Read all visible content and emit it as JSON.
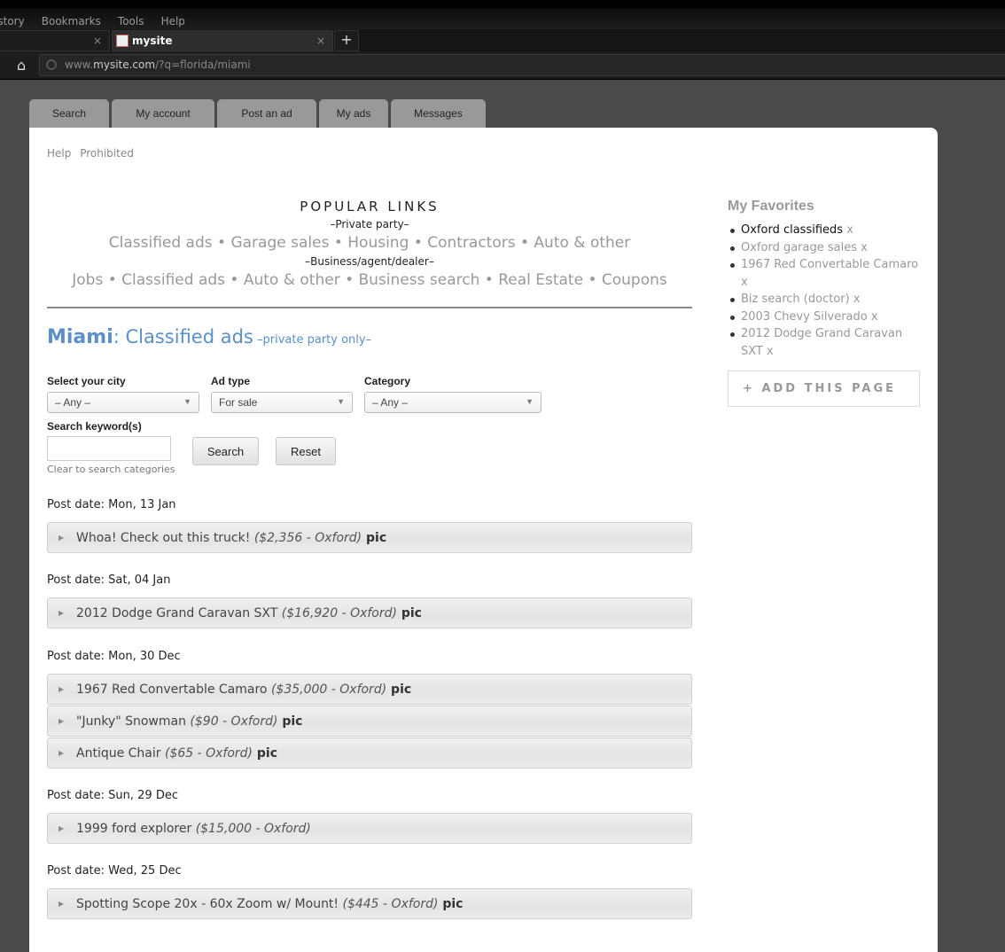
{
  "browser": {
    "menu": [
      "istory",
      "Bookmarks",
      "Tools",
      "Help"
    ],
    "tab_title": "mysite",
    "new_tab": "+",
    "url_prefix": "www.",
    "url_domain": "mysite.com",
    "url_path": "/?q=florida/miami"
  },
  "nav_tabs": [
    "Search",
    "My account",
    "Post an ad",
    "My ads",
    "Messages"
  ],
  "top_links": [
    "Help",
    "Prohibited"
  ],
  "popular": {
    "title": "POPULAR LINKS",
    "private_label": "–Private party–",
    "private_links": "Classified ads • Garage sales • Housing • Contractors • Auto & other",
    "business_label": "–Business/agent/dealer–",
    "business_links": "Jobs • Classified ads • Auto & other • Business search • Real Estate • Coupons"
  },
  "heading": {
    "city": "Miami",
    "title": ": Classified ads",
    "note": " –private party only–"
  },
  "filters": {
    "city_label": "Select your city",
    "city_value": "– Any –",
    "adtype_label": "Ad type",
    "adtype_value": "For sale",
    "category_label": "Category",
    "category_value": "– Any –",
    "keyword_label": "Search keyword(s)",
    "keyword_value": "",
    "hint": "Clear to search categories",
    "search_btn": "Search",
    "reset_btn": "Reset"
  },
  "listings": [
    {
      "date": "Post date: Mon, 13 Jan",
      "ads": [
        {
          "title": "Whoa! Check out this truck! ",
          "meta": "($2,356 - Oxford)",
          "pic": " pic"
        }
      ]
    },
    {
      "date": "Post date: Sat, 04 Jan",
      "ads": [
        {
          "title": "2012 Dodge Grand Caravan SXT ",
          "meta": "($16,920 - Oxford)",
          "pic": " pic"
        }
      ]
    },
    {
      "date": "Post date: Mon, 30 Dec",
      "ads": [
        {
          "title": "1967 Red Convertable Camaro ",
          "meta": "($35,000 - Oxford)",
          "pic": " pic"
        },
        {
          "title": "\"Junky\" Snowman ",
          "meta": "($90 - Oxford)",
          "pic": " pic"
        },
        {
          "title": "Antique Chair ",
          "meta": "($65 - Oxford)",
          "pic": " pic"
        }
      ]
    },
    {
      "date": "Post date: Sun, 29 Dec",
      "ads": [
        {
          "title": "1999 ford explorer ",
          "meta": "($15,000 - Oxford)",
          "pic": ""
        }
      ]
    },
    {
      "date": "Post date: Wed, 25 Dec",
      "ads": [
        {
          "title": "Spotting Scope 20x - 60x Zoom w/ Mount! ",
          "meta": "($445 - Oxford)",
          "pic": " pic"
        }
      ]
    }
  ],
  "favorites": {
    "title": "My Favorites",
    "items": [
      "Oxford classifieds",
      "Oxford garage sales",
      "1967 Red Convertable Camaro",
      "Biz search (doctor)",
      "2003 Chevy Silverado",
      "2012 Dodge Grand Caravan SXT"
    ],
    "remove": "x",
    "add_label": "ADD THIS PAGE",
    "add_icon": "+"
  }
}
